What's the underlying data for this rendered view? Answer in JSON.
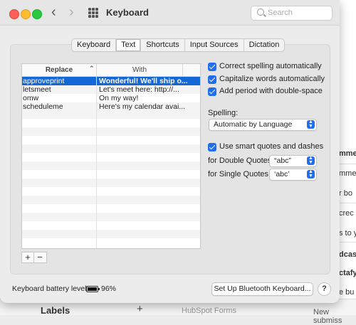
{
  "window": {
    "title": "Keyboard"
  },
  "search": {
    "placeholder": "Search"
  },
  "tabs": [
    {
      "label": "Keyboard",
      "active": false
    },
    {
      "label": "Text",
      "active": true
    },
    {
      "label": "Shortcuts",
      "active": false
    },
    {
      "label": "Input Sources",
      "active": false
    },
    {
      "label": "Dictation",
      "active": false
    }
  ],
  "table": {
    "headers": {
      "replace": "Replace",
      "with": "With"
    },
    "rows": [
      {
        "replace": "approveprint",
        "with": "Wonderful! We'll ship o...",
        "selected": true
      },
      {
        "replace": "letsmeet",
        "with": "Let's meet here: http://...",
        "selected": false
      },
      {
        "replace": "omw",
        "with": "On my way!",
        "selected": false
      },
      {
        "replace": "scheduleme",
        "with": "Here's my calendar avai...",
        "selected": false
      }
    ]
  },
  "options": {
    "correct_spelling": "Correct spelling automatically",
    "capitalize": "Capitalize words automatically",
    "period": "Add period with double-space",
    "spelling_label": "Spelling:",
    "spelling_value": "Automatic by Language",
    "smart_quotes": "Use smart quotes and dashes",
    "double_label": "for Double Quotes",
    "double_value": "“abc”",
    "single_label": "for Single Quotes",
    "single_value": "‘abc’"
  },
  "footer": {
    "battery_label": "Keyboard battery level:",
    "battery_pct": "96%",
    "bt_button": "Set Up Bluetooth Keyboard...",
    "help": "?"
  },
  "background": {
    "fragments": [
      "mme",
      "mme",
      "r bo",
      "crec",
      "s to y",
      "dcas",
      "ctafy",
      "e bu"
    ],
    "labels": "Labels",
    "plus": "+",
    "hubspot": "HubSpot Forms",
    "new_sub": "New submiss"
  }
}
